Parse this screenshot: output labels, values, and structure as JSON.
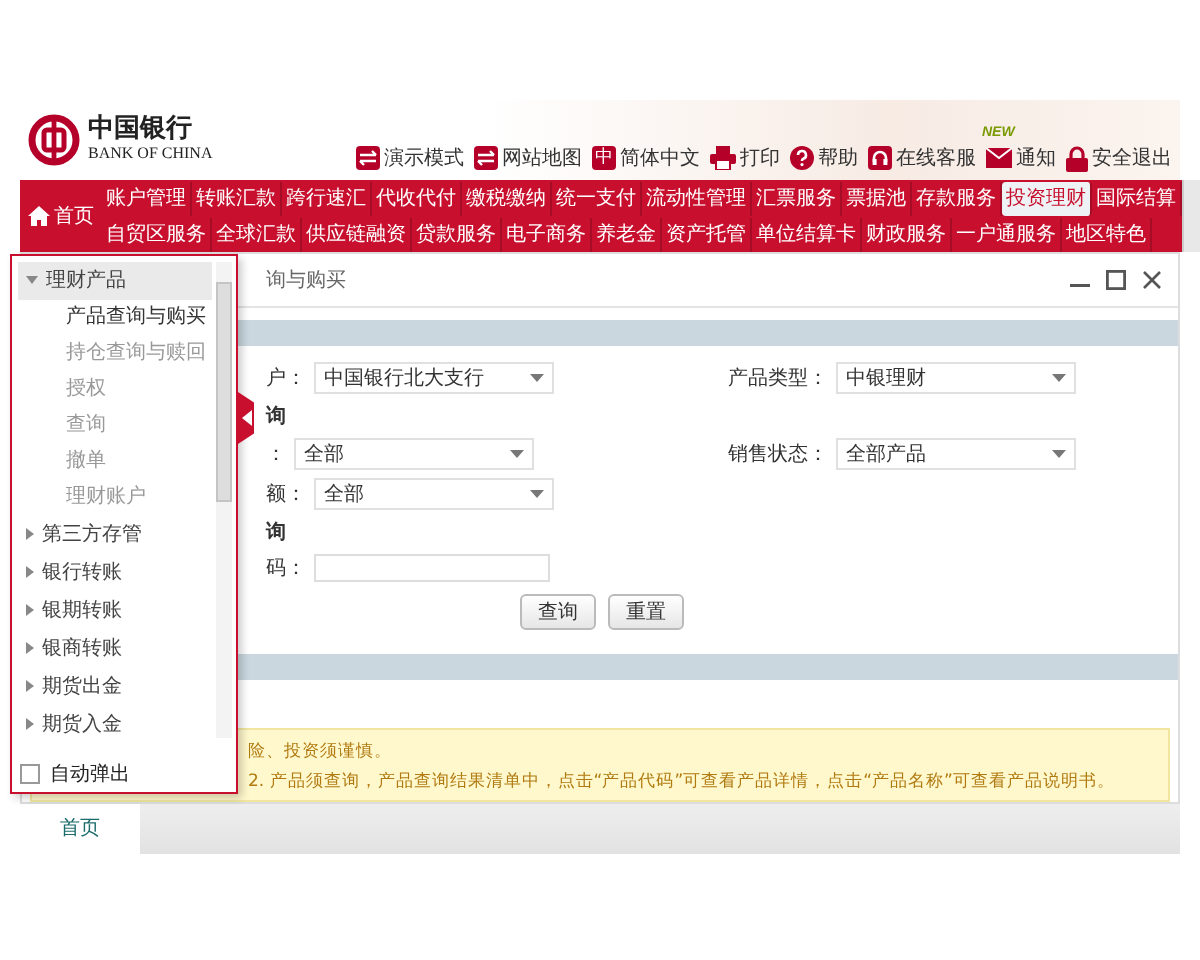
{
  "header": {
    "logo_cn": "中国银行",
    "logo_en": "BANK OF CHINA",
    "links": [
      {
        "kind": "switch",
        "label": "演示模式"
      },
      {
        "kind": "switch",
        "label": "网站地图"
      },
      {
        "kind": "lang",
        "icon_text": "中",
        "label": "简体中文"
      },
      {
        "kind": "print",
        "label": "打印"
      },
      {
        "kind": "help",
        "label": "帮助"
      },
      {
        "kind": "headset",
        "label": "在线客服"
      },
      {
        "kind": "mail",
        "label": "通知",
        "badge": "NEW"
      },
      {
        "kind": "lock",
        "label": "安全退出"
      }
    ]
  },
  "nav": {
    "home": "首页",
    "rows": [
      [
        {
          "label": "账户管理",
          "selected": false
        },
        {
          "label": "转账汇款",
          "selected": false
        },
        {
          "label": "跨行速汇",
          "selected": false
        },
        {
          "label": "代收代付",
          "selected": false
        },
        {
          "label": "缴税缴纳",
          "selected": false
        },
        {
          "label": "统一支付",
          "selected": false
        },
        {
          "label": "流动性管理",
          "selected": false
        },
        {
          "label": "汇票服务",
          "selected": false
        },
        {
          "label": "票据池",
          "selected": false
        },
        {
          "label": "存款服务",
          "selected": false
        },
        {
          "label": "投资理财",
          "selected": true
        },
        {
          "label": "国际结算",
          "selected": false
        }
      ],
      [
        {
          "label": "自贸区服务",
          "selected": false
        },
        {
          "label": "全球汇款",
          "selected": false
        },
        {
          "label": "供应链融资",
          "selected": false
        },
        {
          "label": "贷款服务",
          "selected": false
        },
        {
          "label": "电子商务",
          "selected": false
        },
        {
          "label": "养老金",
          "selected": false
        },
        {
          "label": "资产托管",
          "selected": false
        },
        {
          "label": "单位结算卡",
          "selected": false
        },
        {
          "label": "财政服务",
          "selected": false
        },
        {
          "label": "一户通服务",
          "selected": false
        },
        {
          "label": "地区特色",
          "selected": false
        }
      ]
    ]
  },
  "content": {
    "breadcrumb": "询与购买",
    "rows": [
      {
        "kind": "fields",
        "left": {
          "label": "户：",
          "kind": "select",
          "value": "中国银行北大支行"
        },
        "right": {
          "label": "产品类型：",
          "kind": "select",
          "value": "中银理财"
        }
      },
      {
        "kind": "section",
        "label": "询"
      },
      {
        "kind": "fields",
        "left": {
          "label": "：",
          "kind": "select",
          "value": "全部"
        },
        "right": {
          "label": "销售状态：",
          "kind": "select",
          "value": "全部产品"
        }
      },
      {
        "kind": "fields",
        "left": {
          "label": "额：",
          "kind": "select",
          "value": "全部"
        }
      },
      {
        "kind": "section",
        "label": "询"
      },
      {
        "kind": "fields",
        "left": {
          "label": "码：",
          "kind": "input"
        }
      }
    ],
    "buttons": [
      "查询",
      "重置"
    ],
    "notice": [
      "险、投资须谨慎。",
      "2. 产品须查询，产品查询结果清单中，点击“产品代码”可查看产品详情，点击“产品名称”可查看产品说明书。"
    ]
  },
  "flyout": {
    "groups": [
      {
        "label": "理财产品",
        "expanded": true,
        "children": [
          {
            "label": "产品查询与购买",
            "selected": true
          },
          {
            "label": "持仓查询与赎回",
            "selected": false
          },
          {
            "label": "授权",
            "selected": false
          },
          {
            "label": "查询",
            "selected": false
          },
          {
            "label": "撤单",
            "selected": false
          },
          {
            "label": "理财账户",
            "selected": false
          }
        ]
      },
      {
        "label": "第三方存管",
        "expanded": false
      },
      {
        "label": "银行转账",
        "expanded": false
      },
      {
        "label": "银期转账",
        "expanded": false
      },
      {
        "label": "银商转账",
        "expanded": false
      },
      {
        "label": "期货出金",
        "expanded": false
      },
      {
        "label": "期货入金",
        "expanded": false
      }
    ],
    "auto_popup": {
      "label": "自动弹出",
      "checked": false
    }
  },
  "bottom_tabs": [
    {
      "label": "首页",
      "selected": true
    }
  ]
}
